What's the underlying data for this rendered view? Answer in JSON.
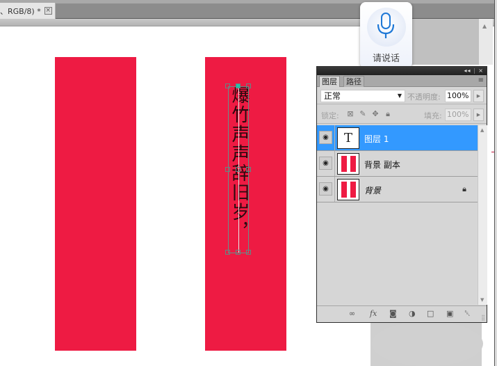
{
  "document": {
    "tab_title": "、RGB/8) *",
    "close_glyph": "×"
  },
  "canvas": {
    "background": "#ffffff",
    "red_color": "#ee1b43",
    "vertical_text": "爆竹声声辞旧岁，"
  },
  "voice_widget": {
    "label": "请说话",
    "icon": "microphone-icon",
    "accent": "#1e78d6"
  },
  "layers_panel": {
    "collapse_glyph": "◂◂",
    "close_glyph": "×",
    "tabs": [
      {
        "label": "图层",
        "active": true
      },
      {
        "label": "路径",
        "active": false
      }
    ],
    "menu_glyph": "≡",
    "blend_mode": "正常",
    "opacity_label": "不透明度:",
    "opacity_value": "100%",
    "lock_label": "锁定:",
    "fill_label": "填充:",
    "fill_value": "100%",
    "layers": [
      {
        "name": "图层 1",
        "type": "text",
        "thumb_glyph": "T",
        "selected": true,
        "visible": true,
        "locked": false
      },
      {
        "name": "背景 副本",
        "type": "image",
        "selected": false,
        "visible": true,
        "locked": false
      },
      {
        "name": "背景",
        "type": "image",
        "selected": false,
        "visible": true,
        "locked": true
      }
    ],
    "bottom_buttons": [
      {
        "name": "link-layers",
        "glyph": "∞"
      },
      {
        "name": "layer-style",
        "glyph": "fx"
      },
      {
        "name": "add-mask",
        "glyph": "◙"
      },
      {
        "name": "adjustment-layer",
        "glyph": "◑"
      },
      {
        "name": "new-group",
        "glyph": "□"
      },
      {
        "name": "new-layer",
        "glyph": "▣"
      },
      {
        "name": "delete-layer",
        "glyph": "␡"
      }
    ],
    "selection_color": "#3399ff"
  }
}
